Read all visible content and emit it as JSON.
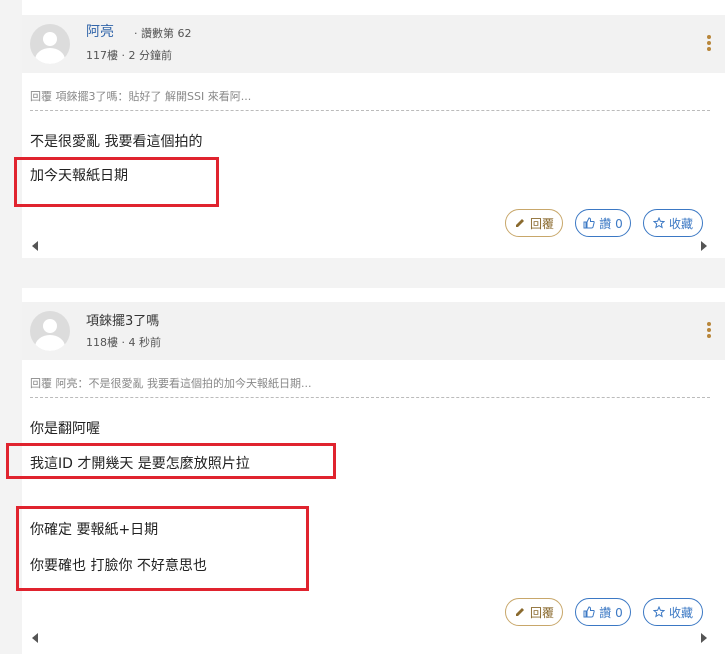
{
  "posts": [
    {
      "author": "阿亮",
      "score_text": "· 讚數第 62",
      "meta": "117樓 · 2 分鐘前",
      "reply_ref": "回覆 項錸擺3了嗎：貼好了 解開SSI 來看阿...",
      "lines": [
        "不是很愛亂 我要看這個拍的",
        "加今天報紙日期"
      ],
      "buttons": {
        "reply": "回覆",
        "like": "讚 0",
        "fav": "收藏"
      }
    },
    {
      "author": "項錸擺3了嗎",
      "meta": "118樓 · 4 秒前",
      "reply_ref": "回覆 阿亮：不是很愛亂 我要看這個拍的加今天報紙日期...",
      "lines": [
        "你是翻阿喔",
        "我這ID 才開幾天 是要怎麼放照片拉",
        "你確定 要報紙+日期",
        "你要確也 打臉你 不好意思也"
      ],
      "buttons": {
        "reply": "回覆",
        "like": "讚 0",
        "fav": "收藏"
      }
    }
  ],
  "colors": {
    "highlight": "#e0232e",
    "accent": "#3b78c4",
    "reply": "#c8a76a"
  }
}
